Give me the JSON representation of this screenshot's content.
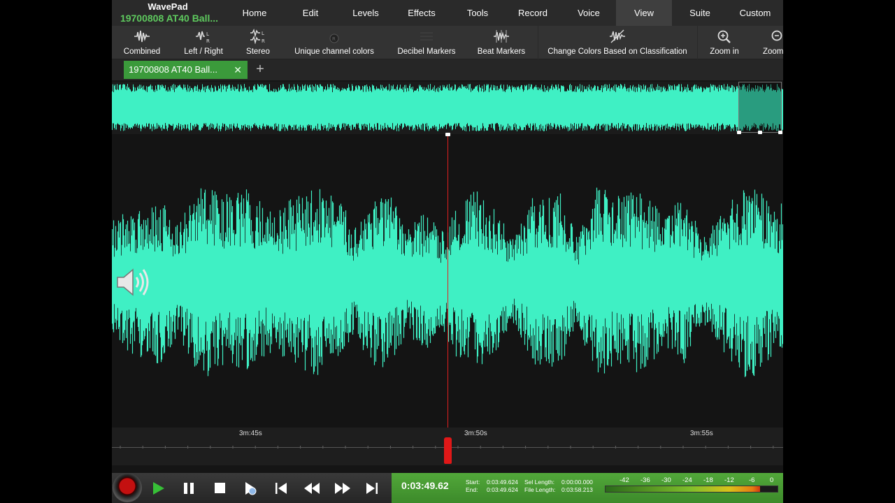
{
  "app": {
    "name": "WavePad",
    "file_name": "19700808 AT40 Ball..."
  },
  "menu": [
    {
      "label": "Home",
      "active": false
    },
    {
      "label": "Edit",
      "active": false
    },
    {
      "label": "Levels",
      "active": false
    },
    {
      "label": "Effects",
      "active": false
    },
    {
      "label": "Tools",
      "active": false
    },
    {
      "label": "Record",
      "active": false
    },
    {
      "label": "Voice",
      "active": false
    },
    {
      "label": "View",
      "active": true
    },
    {
      "label": "Suite",
      "active": false
    },
    {
      "label": "Custom",
      "active": false
    }
  ],
  "toolbar": {
    "combined": "Combined",
    "left_right": "Left / Right",
    "stereo": "Stereo",
    "unique_colors": "Unique channel colors",
    "decibel_markers": "Decibel Markers",
    "beat_markers": "Beat Markers",
    "change_colors": "Change Colors Based on Classification",
    "zoom_in": "Zoom in",
    "zoom_out": "Zoom"
  },
  "tabs": {
    "file_tab": "19700808 AT40 Ball...",
    "close": "✕",
    "add": "+"
  },
  "timeline": {
    "ticks": [
      "3m:45s",
      "3m:50s",
      "3m:55s"
    ]
  },
  "transport": {
    "current_time": "0:03:49.62",
    "start_label": "Start:",
    "start_value": "0:03:49.624",
    "end_label": "End:",
    "end_value": "0:03:49.624",
    "sel_length_label": "Sel Length:",
    "sel_length_value": "0:00:00.000",
    "file_length_label": "File Length:",
    "file_length_value": "0:03:58.213",
    "level_scale": [
      "-42",
      "-36",
      "-30",
      "-24",
      "-18",
      "-12",
      "-6",
      "0"
    ],
    "level_fraction": 0.9
  },
  "colors": {
    "waveform": "#3ff0c4",
    "accent_green": "#3b9a3b",
    "cursor": "#e02020"
  }
}
